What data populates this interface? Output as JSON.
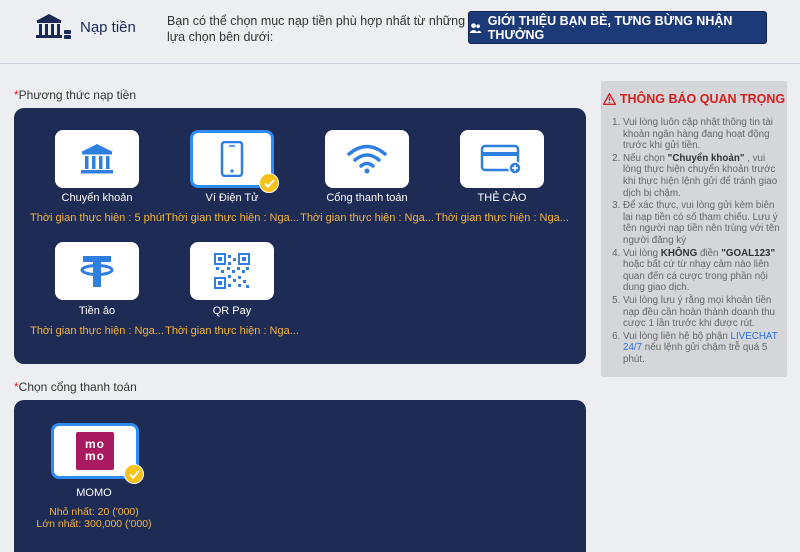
{
  "header": {
    "title": "Nạp tiền",
    "description": "Bạn có thể chọn mục nạp tiền phù hợp nhất từ những lựa chọn bên dưới:",
    "referral_button": "GIỚI THIỆU BẠN BÈ, TƯNG BỪNG NHẬN THƯỞNG"
  },
  "methods_section": {
    "required_mark": "*",
    "label": "Phương thức nạp tiền",
    "items": [
      {
        "name": "Chuyển khoản",
        "time": "Thời gian thực hiện :  5 phút",
        "icon": "bank-icon",
        "selected": false
      },
      {
        "name": "Ví Điện Tử",
        "time": "Thời gian thực hiện :  Nga...",
        "icon": "smartphone-icon",
        "selected": true
      },
      {
        "name": "Cổng thanh toán",
        "time": "Thời gian thực hiện :  Nga...",
        "icon": "wifi-icon",
        "selected": false
      },
      {
        "name": "THẺ CÀO",
        "time": "Thời gian thực hiện :  Nga...",
        "icon": "card-icon",
        "selected": false
      },
      {
        "name": "Tiền ảo",
        "time": "Thời gian thực hiện :  Nga...",
        "icon": "tether-icon",
        "selected": false
      },
      {
        "name": "QR Pay",
        "time": "Thời gian thực hiện :  Nga...",
        "icon": "qr-code-icon",
        "selected": false
      }
    ]
  },
  "gateway_section": {
    "required_mark": "*",
    "label": "Chọn cổng thanh toán",
    "items": [
      {
        "name": "MOMO",
        "logo_text": "mo mo",
        "min": "Nhỏ nhất: 20 ('000)",
        "max": "Lớn nhất: 300,000 ('000)",
        "selected": true
      }
    ]
  },
  "notice": {
    "title": "THÔNG BÁO QUAN TRỌNG",
    "items": [
      {
        "text": "Vui lòng luôn cập nhật thông tin tài khoản ngân hàng đang hoạt động trước khi gửi tiền."
      },
      {
        "pre": "Nếu chọn ",
        "highlight": "\"Chuyển khoản\"",
        "post": " , vui lòng thực hiện chuyển khoản trước khi thực hiện lệnh gửi để tránh giao dịch bị chậm."
      },
      {
        "text": "Để xác thực, vui lòng gửi kèm biên lai nạp tiền có số tham chiếu. Lưu ý tên người nạp tiền nên trùng với tên người đăng ký"
      },
      {
        "pre": "Vui lòng ",
        "highlight": "KHÔNG",
        "mid": " điền ",
        "highlight2": "\"GOAL123\"",
        "post": " hoặc bất cứ từ nhạy cảm nào liên quan đến cá cược trong phần nội dung giao dịch."
      },
      {
        "text": "Vui lòng lưu ý rằng mọi khoản tiền nạp đều cần hoàn thành doanh thu cược 1 lần trước khi được rút."
      },
      {
        "pre": "Vui lòng liên hệ bộ phận ",
        "link": "LIVECHAT 24/7",
        "post": " nếu lệnh gửi chậm trễ quá 5 phút."
      }
    ]
  },
  "colors": {
    "panel_bg": "#1e2b55",
    "accent_blue": "#2f8cf0",
    "time_text": "#f4b53a",
    "notice_title": "#d42020",
    "check_badge": "#f4c218"
  }
}
